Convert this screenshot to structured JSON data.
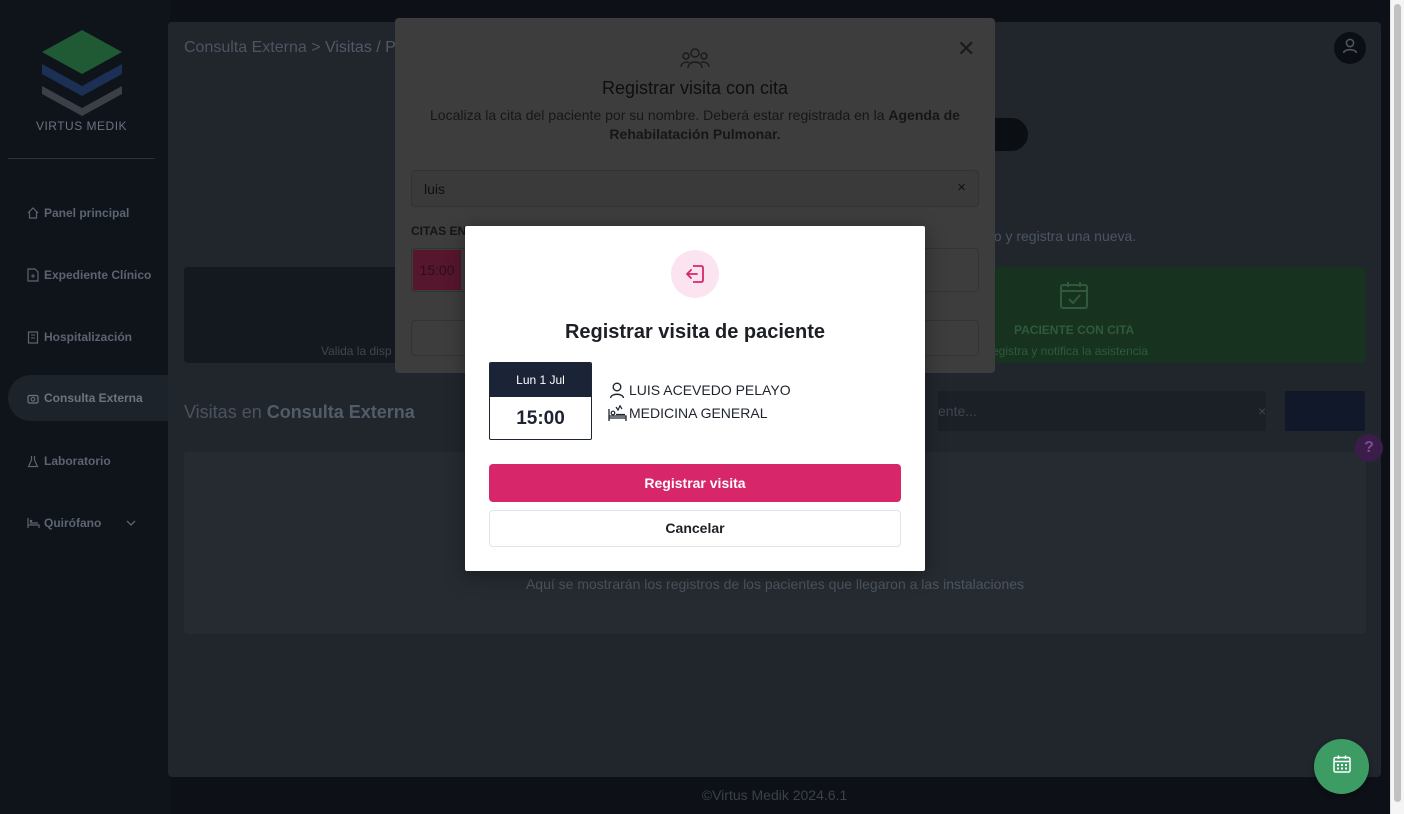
{
  "sidebar": {
    "brand": "VIRTUS MEDIK",
    "items": [
      {
        "label": "Panel principal",
        "icon": "home-icon"
      },
      {
        "label": "Expediente Clínico",
        "icon": "file-icon"
      },
      {
        "label": "Hospitalización",
        "icon": "building-icon"
      },
      {
        "label": "Consulta Externa",
        "icon": "camera-icon",
        "active": true
      },
      {
        "label": "Laboratorio",
        "icon": "flask-icon"
      },
      {
        "label": "Quirófano",
        "icon": "surgery-bed-icon",
        "expandable": true
      }
    ]
  },
  "header": {
    "breadcrumb_root": "Consulta Externa",
    "breadcrumb_separator": ">",
    "breadcrumb_current": "Visitas / P"
  },
  "main": {
    "hint_right": "do y registra una nueva.",
    "card_dark_sub": "Valida la disp",
    "card_green_title": "PACIENTE CON CITA",
    "card_green_sub": "egistra y notifica la asistencia",
    "visits_title_prefix": "Visitas en ",
    "visits_title_bold": "Consulta Externa",
    "search_placeholder_tail": "ente...",
    "search_clear": "×",
    "empty_text": "Aquí se mostrarán los registros de los pacientes que llegaron a las instalaciones",
    "help_label": "?"
  },
  "footer": {
    "text": "©Virtus Medik 2024.6.1"
  },
  "modal_cita": {
    "title": "Registrar visita con cita",
    "desc_plain": "Localiza la cita del paciente por su nombre. Deberá estar registrada en la ",
    "desc_bold": "Agenda de Rehabilatación Pulmonar.",
    "search_value": "luis",
    "clear_label": "×",
    "close_label": "✕",
    "section_label": "CITAS EN",
    "appointment_time": "15:00"
  },
  "modal_visita": {
    "title": "Registrar visita de paciente",
    "date_label": "Lun 1 Jul",
    "time_label": "15:00",
    "patient_name": "LUIS ACEVEDO PELAYO",
    "specialty": "MEDICINA GENERAL",
    "confirm_label": "Registrar visita",
    "cancel_label": "Cancelar"
  },
  "colors": {
    "primary": "#d8266b",
    "navy": "#1b2436",
    "fab_green": "#3c9c63"
  }
}
